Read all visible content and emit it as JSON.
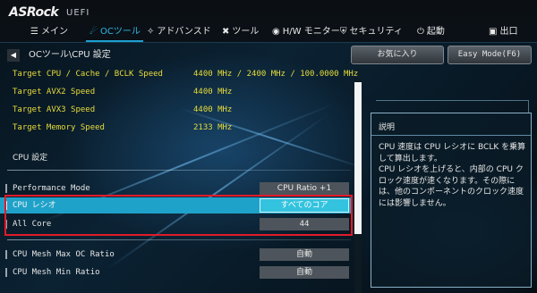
{
  "brand": {
    "logo": "ASRock",
    "sub": "UEFI"
  },
  "tabs": [
    {
      "icon": "☰",
      "label": "メイン",
      "active": false
    },
    {
      "icon": "☄",
      "label": "OCツール",
      "active": true
    },
    {
      "icon": "✧",
      "label": "アドバンスド",
      "active": false
    },
    {
      "icon": "✖",
      "label": "ツール",
      "active": false
    },
    {
      "icon": "◉",
      "label": "H/W モニター",
      "active": false
    },
    {
      "icon": "⛨",
      "label": "セキュリティ",
      "active": false
    },
    {
      "icon": "⏻",
      "label": "起動",
      "active": false
    },
    {
      "icon": "▣",
      "label": "出口",
      "active": false
    }
  ],
  "breadcrumb": {
    "back_arrow": "◀",
    "path": "OCツール\\CPU 設定"
  },
  "buttons": {
    "favorite": "お気に入り",
    "easy_mode": "Easy Mode(F6)"
  },
  "info_rows": [
    {
      "label": "Target CPU / Cache / BCLK Speed",
      "value": "4400 MHz / 2400 MHz / 100.0000 MHz"
    },
    {
      "label": "Target AVX2 Speed",
      "value": "4400 MHz"
    },
    {
      "label": "Target AVX3 Speed",
      "value": "4400 MHz"
    },
    {
      "label": "Target Memory Speed",
      "value": "2133 MHz"
    }
  ],
  "section_title": "CPU 設定",
  "settings": [
    {
      "label": "Performance Mode",
      "value": "CPU Ratio +1",
      "selected": false
    },
    {
      "label": "CPU レシオ",
      "value": "すべてのコア",
      "selected": true
    },
    {
      "label": "All Core",
      "value": "44",
      "selected": false
    },
    {
      "label": "CPU Mesh Max OC Ratio",
      "value": "自動",
      "selected": false
    },
    {
      "label": "CPU Mesh Min Ratio",
      "value": "自動",
      "selected": false
    }
  ],
  "help": {
    "title": "説明",
    "text": "CPU 速度は CPU レシオに BCLK を乗算して算出します。\nCPU レシオを上げると、内部の CPU クロック速度が速くなります。その際には、他のコンポーネントのクロック速度には影響しません。"
  }
}
